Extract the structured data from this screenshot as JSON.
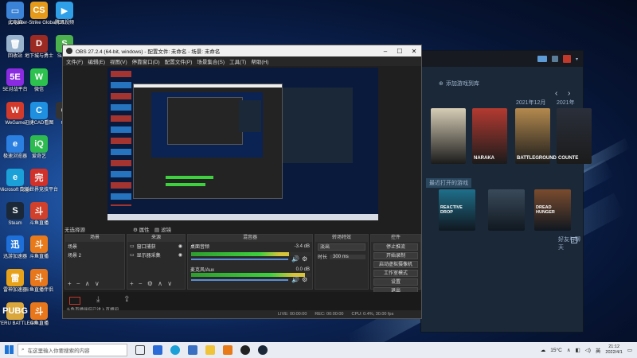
{
  "desktop": {
    "icons": [
      {
        "label": "此电脑",
        "color": "#3b83d6",
        "glyph": "▭"
      },
      {
        "label": "Counter-Strike Global Off...",
        "color": "#e59a1a",
        "glyph": "CS"
      },
      {
        "label": "腾讯视频",
        "color": "#2f9fe8",
        "glyph": "▶"
      },
      {
        "label": "回收站",
        "color": "#9ab3cc",
        "glyph": "🗑"
      },
      {
        "label": "地下城与勇士",
        "color": "#9b2a22",
        "glyph": "D"
      },
      {
        "label": "Surrou",
        "color": "#4cb04c",
        "glyph": "S"
      },
      {
        "label": "5E对战平台",
        "color": "#8a2be2",
        "glyph": "5E"
      },
      {
        "label": "微信",
        "color": "#2dc14e",
        "glyph": "W"
      },
      {
        "label": "WeGame",
        "color": "#d23b2c",
        "glyph": "W"
      },
      {
        "label": "迅捷CAD看图",
        "color": "#1f8fe0",
        "glyph": "C"
      },
      {
        "label": "OB",
        "color": "#333333",
        "glyph": "O"
      },
      {
        "label": "极速浏览器",
        "color": "#2a7fe0",
        "glyph": "e"
      },
      {
        "label": "爱奇艺",
        "color": "#2dbb4f",
        "glyph": "iQ"
      },
      {
        "label": "Microsoft Edge",
        "color": "#1ba0d8",
        "glyph": "e"
      },
      {
        "label": "完美世界竞技平台",
        "color": "#d2312a",
        "glyph": "完"
      },
      {
        "label": "Steam",
        "color": "#1b2838",
        "glyph": "S"
      },
      {
        "label": "斗鱼直播",
        "color": "#d0402a",
        "glyph": "斗"
      },
      {
        "label": "迅游加速器",
        "color": "#1e6fd8",
        "glyph": "迅"
      },
      {
        "label": "斗鱼直播",
        "color": "#e87a1a",
        "glyph": "斗"
      },
      {
        "label": "雷神加速器",
        "color": "#e8a21a",
        "glyph": "雷"
      },
      {
        "label": "斗鱼直播伴侣",
        "color": "#e8761a",
        "glyph": "斗"
      },
      {
        "label": "PLAYERU BATTLEGR...",
        "color": "#d9a73c",
        "glyph": "PUBG"
      },
      {
        "label": "斗鱼直播",
        "color": "#e8761a",
        "glyph": "斗"
      }
    ],
    "overlay_text": "斗鱼直播伴侣已进入直播间"
  },
  "obs": {
    "title": "OBS 27.2.4 (64-bit, windows) - 配置文件: 未命名 - 场景: 未命名",
    "menu": [
      "文件(F)",
      "编辑(E)",
      "视图(V)",
      "停靠窗口(D)",
      "配置文件(P)",
      "场景集合(S)",
      "工具(T)",
      "帮助(H)"
    ],
    "scene_label": "无选择源",
    "scene_tabs": {
      "properties": "属性",
      "filters": "滤镜"
    },
    "docks": {
      "scenes": {
        "title": "场景",
        "items": [
          "场景",
          "场景 2"
        ]
      },
      "sources": {
        "title": "来源",
        "items": [
          "窗口捕获",
          "显示器采集"
        ]
      },
      "mixer": {
        "title": "混音器",
        "channels": [
          {
            "name": "桌面音频",
            "level": "-3.4 dB"
          },
          {
            "name": "麦克风/Aux",
            "level": "0.0 dB"
          }
        ]
      },
      "transitions": {
        "title": "转场特效",
        "type": "淡出",
        "duration_label": "时长",
        "duration": "300 ms"
      },
      "controls": {
        "title": "控件",
        "buttons": [
          "停止推流",
          "开始录制",
          "启动虚拟摄像机",
          "工作室模式",
          "设置",
          "退出"
        ]
      }
    },
    "status": {
      "live": "LIVE: 00:00:00",
      "rec": "REC: 00:00:00",
      "cpu": "CPU: 0.4%, 30.00 fps"
    }
  },
  "steam": {
    "search_label": "添加游戏到库",
    "year_labels": [
      "2021年12月",
      "2021年"
    ],
    "section_label": "最近打开的游戏",
    "games_row1": [
      {
        "name": "",
        "color": "#d7cdb6"
      },
      {
        "name": "NARAKA",
        "color": "#b33a31"
      },
      {
        "name": "BATTLEGROUNDS",
        "color": "#b48a4e"
      },
      {
        "name": "COUNTE",
        "color": "#2a2f3a"
      }
    ],
    "games_row2": [
      {
        "name": "REACTIVE DROP",
        "color": "#1e6f8a"
      },
      {
        "name": "",
        "color": "#3a4a5a"
      },
      {
        "name": "DREAD HUNGER",
        "color": "#7a4c2e"
      }
    ],
    "friends_label": "好友与聊天"
  },
  "taskbar": {
    "search_placeholder": "在这里输入你要搜索的内容",
    "temperature": "15°C",
    "ime": "英",
    "time": "21:12",
    "date": "2022/4/1"
  }
}
